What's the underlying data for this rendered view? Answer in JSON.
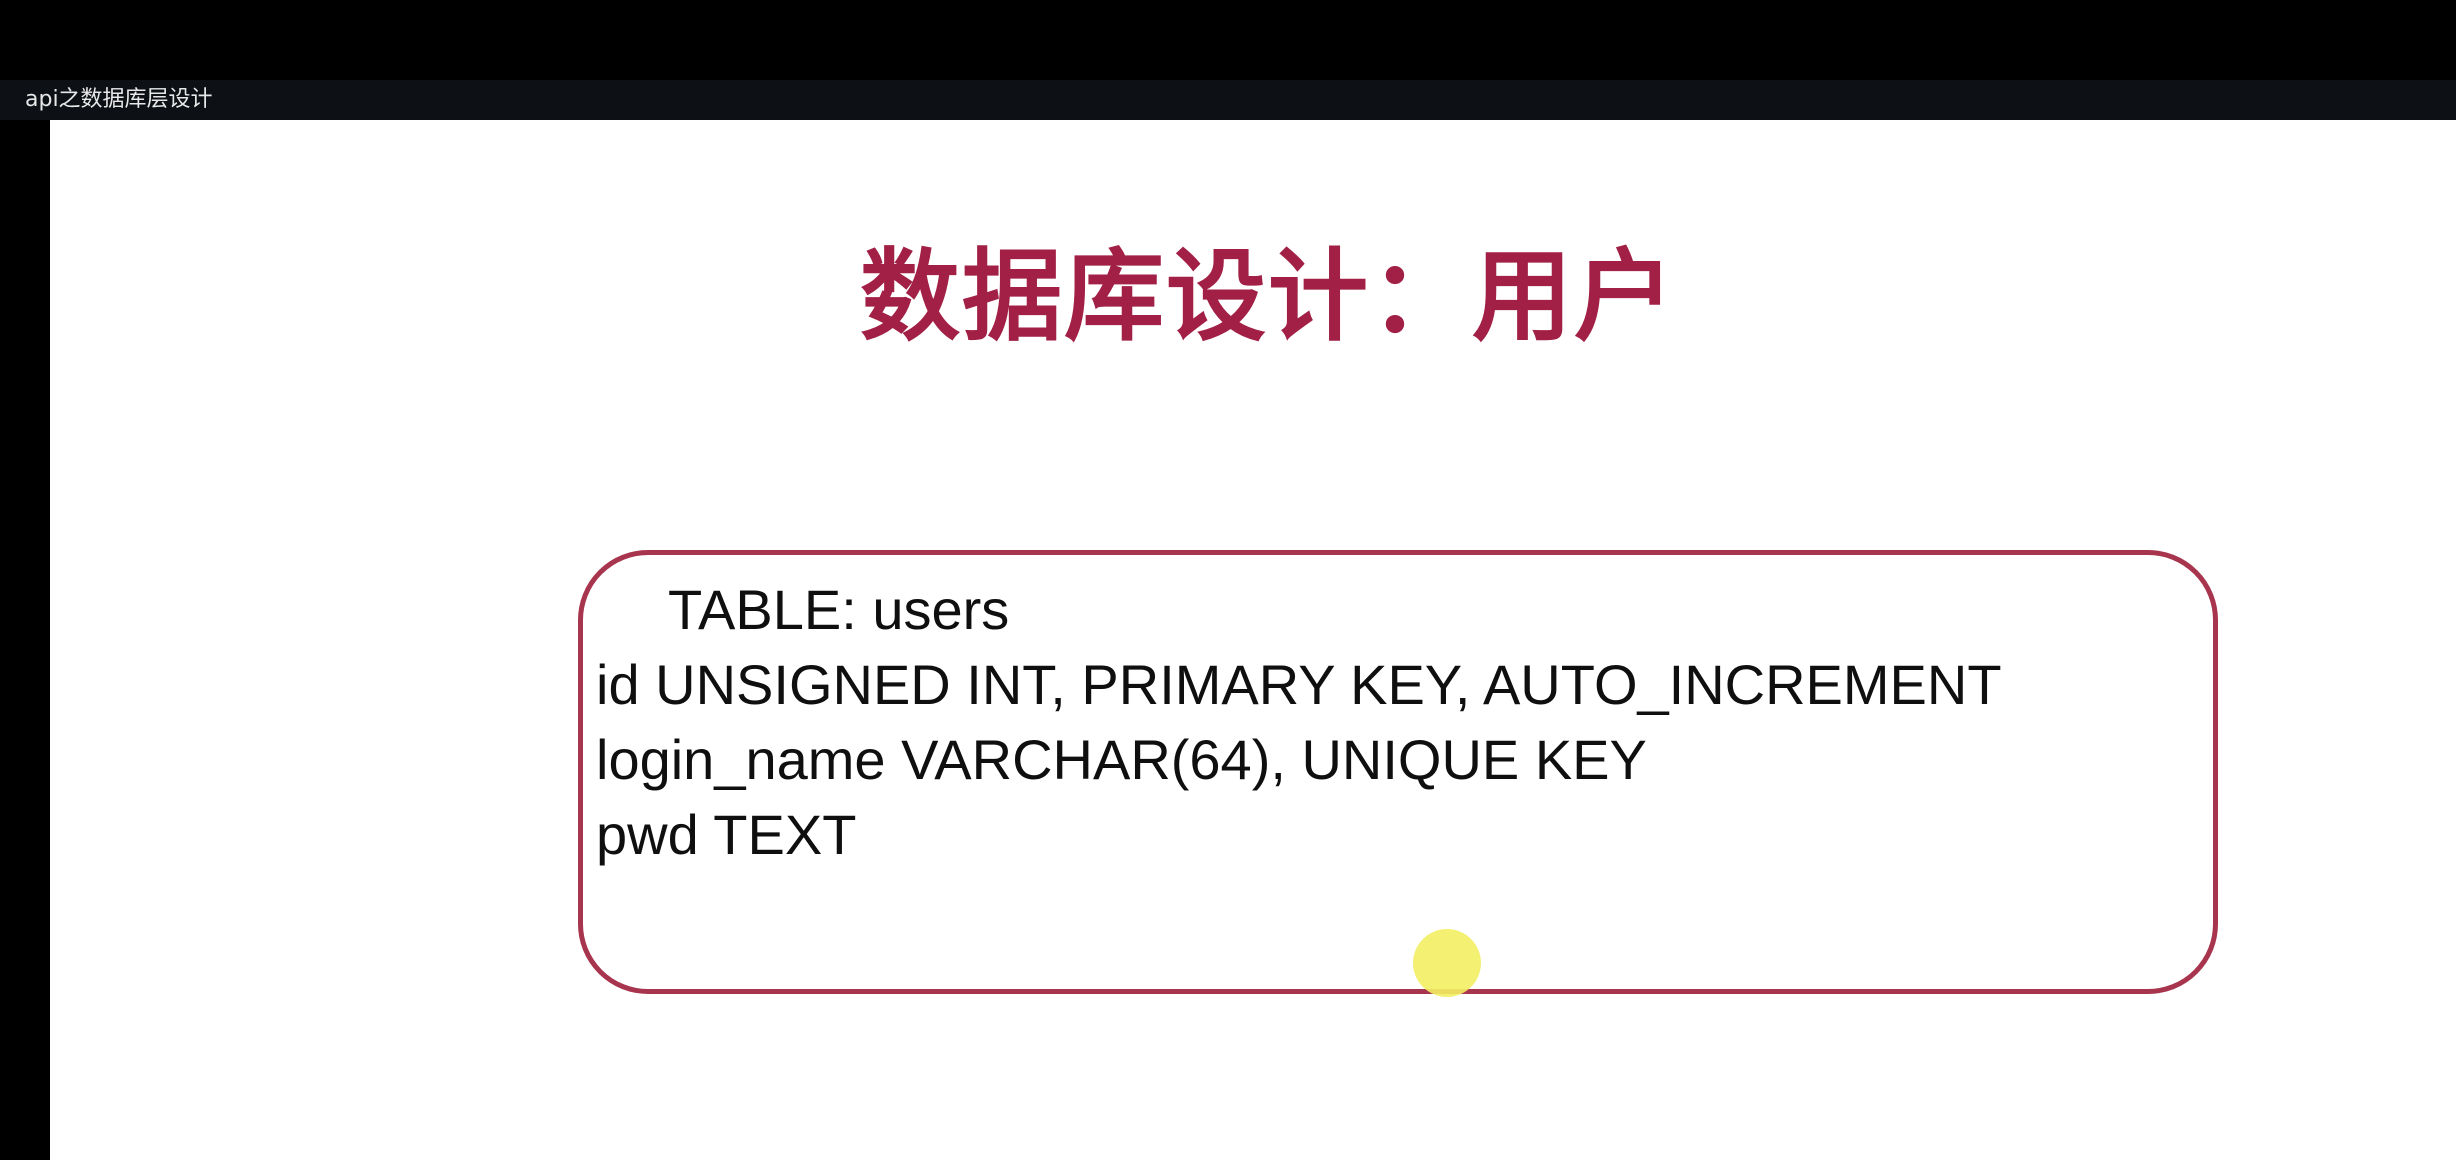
{
  "window": {
    "title": "api之数据库层设计"
  },
  "slide": {
    "title": "数据库设计：用户",
    "table_line": "TABLE: users",
    "columns": [
      "id UNSIGNED INT, PRIMARY KEY, AUTO_INCREMENT",
      "login_name VARCHAR(64), UNIQUE KEY",
      "pwd TEXT"
    ]
  },
  "colors": {
    "title": "#a21f45",
    "box_border": "#a8354e",
    "cursor_highlight": "#f2ee63",
    "title_strip": "#0d1116"
  },
  "cursor": {
    "icon": "cursor-highlight-icon"
  }
}
